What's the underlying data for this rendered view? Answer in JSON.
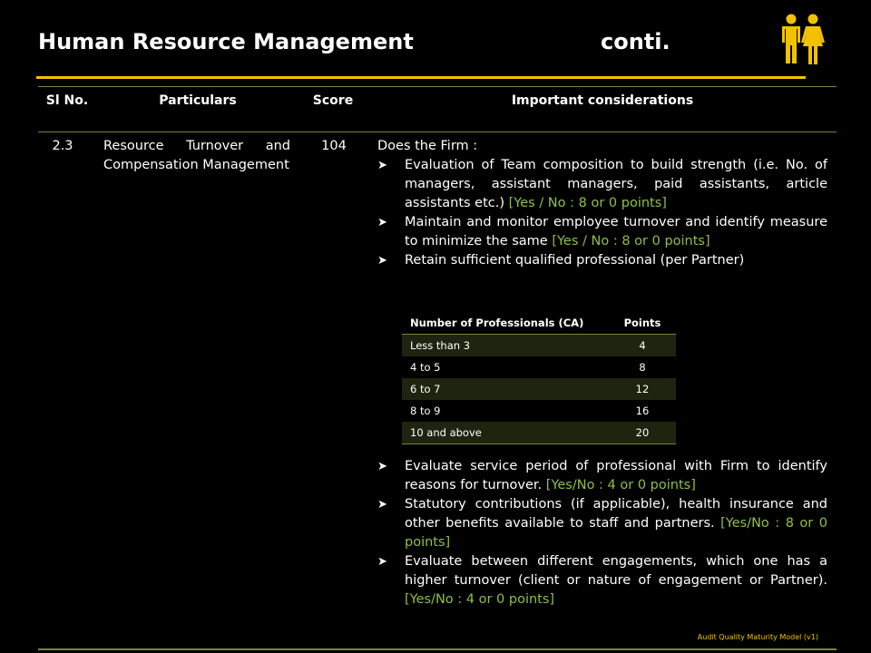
{
  "header": {
    "title": "Human Resource Management",
    "title_suffix": "conti.",
    "icon": "people-icon"
  },
  "table": {
    "columns": [
      "Sl No.",
      "Particulars",
      "Score",
      "Important considerations"
    ],
    "row": {
      "sl": "2.3",
      "particulars": "Resource Turnover and Compensation Management",
      "score": "104",
      "intro": "Does the Firm :",
      "bullets_before": [
        {
          "text": "Evaluation of Team composition to build strength (i.e. No. of managers, assistant managers, paid assistants, article assistants etc.) ",
          "points": "[Yes / No : 8 or 0 points]"
        },
        {
          "text": "Maintain and monitor employee turnover and identify measure to minimize the same ",
          "points": "[Yes / No : 8 or 0 points]"
        },
        {
          "text": "Retain sufficient qualified professional (per Partner)",
          "points": ""
        }
      ],
      "points_table": {
        "headers": [
          "Number of Professionals (CA)",
          "Points"
        ],
        "rows": [
          [
            "Less than 3",
            "4"
          ],
          [
            "4 to 5",
            "8"
          ],
          [
            "6 to 7",
            "12"
          ],
          [
            "8 to 9",
            "16"
          ],
          [
            "10 and above",
            "20"
          ]
        ]
      },
      "bullets_after": [
        {
          "text": "Evaluate service period of professional with Firm to identify reasons for turnover. ",
          "points": "[Yes/No : 4 or 0 points]"
        },
        {
          "text": "Statutory contributions (if applicable), health insurance and other benefits available to staff and partners. ",
          "points": "[Yes/No : 8 or 0 points]"
        },
        {
          "text": "Evaluate between different engagements, which one has a higher turnover (client or nature of engagement or Partner). ",
          "points": "[Yes/No : 4 or 0 points]"
        }
      ]
    }
  },
  "footer": "Audit Quality Maturity Model (v1)",
  "colors": {
    "background": "#000000",
    "accent": "#f2c200",
    "rule": "#6f8a3c",
    "points_text": "#8fbf4a",
    "row_band": "#1f2410"
  }
}
